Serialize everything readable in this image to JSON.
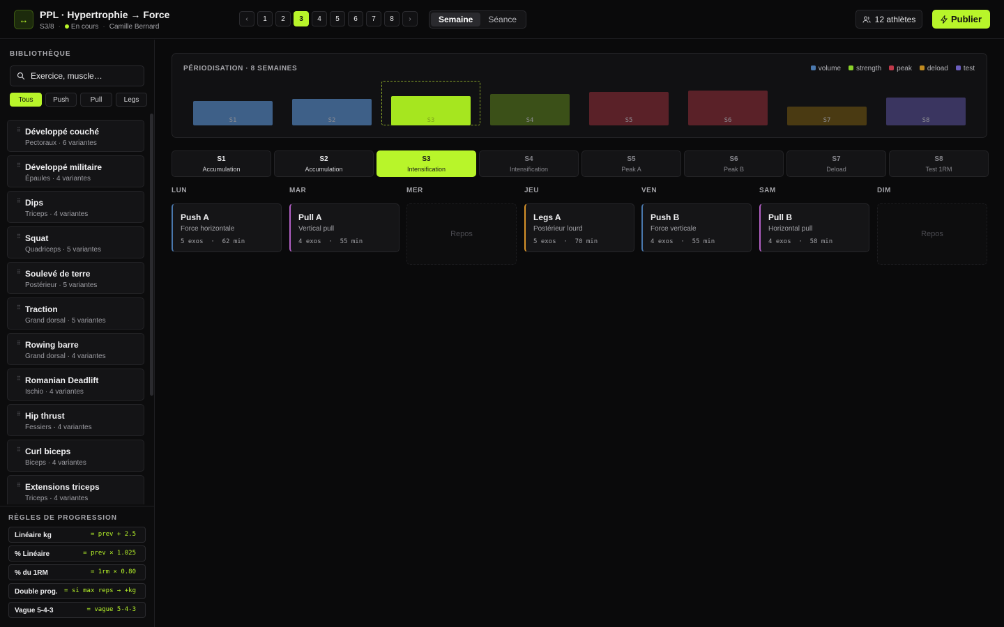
{
  "header": {
    "logo_glyph": "↔",
    "title": "PPL · Hypertrophie → Force",
    "week_progress": "S3/8",
    "status": "En cours",
    "coach": "Camille Bernard",
    "pager": {
      "prev": "‹",
      "next": "›",
      "pages": [
        "1",
        "2",
        "3",
        "4",
        "5",
        "6",
        "7",
        "8"
      ],
      "active": "3",
      "marked": "7"
    },
    "view_toggle": {
      "options": [
        "Semaine",
        "Séance"
      ],
      "selected": "Semaine"
    },
    "athletes_label": "12 athlètes",
    "publish_label": "Publier"
  },
  "sidebar": {
    "title": "BIBLIOTHÈQUE",
    "search_placeholder": "Exercice, muscle…",
    "filters": [
      "Tous",
      "Push",
      "Pull",
      "Legs"
    ],
    "filter_selected": "Tous",
    "exercises": [
      {
        "name": "Développé couché",
        "sub": "Pectoraux · 6 variantes"
      },
      {
        "name": "Développé militaire",
        "sub": "Épaules · 4 variantes"
      },
      {
        "name": "Dips",
        "sub": "Triceps · 4 variantes"
      },
      {
        "name": "Squat",
        "sub": "Quadriceps · 5 variantes"
      },
      {
        "name": "Soulevé de terre",
        "sub": "Postérieur · 5 variantes"
      },
      {
        "name": "Traction",
        "sub": "Grand dorsal · 5 variantes"
      },
      {
        "name": "Rowing barre",
        "sub": "Grand dorsal · 4 variantes"
      },
      {
        "name": "Romanian Deadlift",
        "sub": "Ischio · 4 variantes"
      },
      {
        "name": "Hip thrust",
        "sub": "Fessiers · 4 variantes"
      },
      {
        "name": "Curl biceps",
        "sub": "Biceps · 4 variantes"
      },
      {
        "name": "Extensions triceps",
        "sub": "Triceps · 4 variantes"
      }
    ],
    "progression_title": "RÈGLES DE PROGRESSION",
    "rules": [
      {
        "name": "Linéaire kg",
        "formula": "= prev + 2.5"
      },
      {
        "name": "% Linéaire",
        "formula": "= prev × 1.025"
      },
      {
        "name": "% du 1RM",
        "formula": "= 1rm × 0.80"
      },
      {
        "name": "Double prog.",
        "formula": "= si max reps → +kg"
      },
      {
        "name": "Vague 5-4-3",
        "formula": "= vague 5-4-3"
      }
    ]
  },
  "periodization": {
    "title": "PÉRIODISATION · 8 SEMAINES",
    "legend": [
      {
        "label": "volume",
        "color": "#4a78ad"
      },
      {
        "label": "strength",
        "color": "#8ad12a"
      },
      {
        "label": "peak",
        "color": "#c0394a"
      },
      {
        "label": "deload",
        "color": "#c08a1f"
      },
      {
        "label": "test",
        "color": "#6c5fc0"
      }
    ],
    "chart_data": {
      "type": "bar",
      "categories": [
        "S1",
        "S2",
        "S3",
        "S4",
        "S5",
        "S6",
        "S7",
        "S8"
      ],
      "values": [
        35,
        38,
        42,
        45,
        48,
        50,
        27,
        40
      ],
      "phase": [
        "volume",
        "volume",
        "strength",
        "strength",
        "peak",
        "peak",
        "deload",
        "test"
      ],
      "colors": [
        "#3e6088",
        "#3e6088",
        "#a6e61f",
        "#3b5018",
        "#5a2128",
        "#5a2128",
        "#4a3a12",
        "#3a3560"
      ],
      "selected": "S3"
    }
  },
  "weeks": [
    {
      "num": "S1",
      "phase": "Accumulation"
    },
    {
      "num": "S2",
      "phase": "Accumulation"
    },
    {
      "num": "S3",
      "phase": "Intensification"
    },
    {
      "num": "S4",
      "phase": "Intensification"
    },
    {
      "num": "S5",
      "phase": "Peak A"
    },
    {
      "num": "S6",
      "phase": "Peak B"
    },
    {
      "num": "S7",
      "phase": "Deload"
    },
    {
      "num": "S8",
      "phase": "Test 1RM"
    }
  ],
  "week_selected": "S3",
  "days": [
    {
      "label": "LUN",
      "session": {
        "name": "Push A",
        "focus": "Force horizontale",
        "meta": "5 exos  ·  62 min",
        "color": "#4a78ad"
      }
    },
    {
      "label": "MAR",
      "session": {
        "name": "Pull A",
        "focus": "Vertical pull",
        "meta": "4 exos  ·  55 min",
        "color": "#b561c8"
      }
    },
    {
      "label": "MER",
      "rest": "Repos"
    },
    {
      "label": "JEU",
      "session": {
        "name": "Legs A",
        "focus": "Postérieur lourd",
        "meta": "5 exos  ·  70 min",
        "color": "#d8932a"
      }
    },
    {
      "label": "VEN",
      "session": {
        "name": "Push B",
        "focus": "Force verticale",
        "meta": "4 exos  ·  55 min",
        "color": "#4a78ad"
      }
    },
    {
      "label": "SAM",
      "session": {
        "name": "Pull B",
        "focus": "Horizontal pull",
        "meta": "4 exos  ·  58 min",
        "color": "#b561c8"
      }
    },
    {
      "label": "DIM",
      "rest": "Repos"
    }
  ]
}
